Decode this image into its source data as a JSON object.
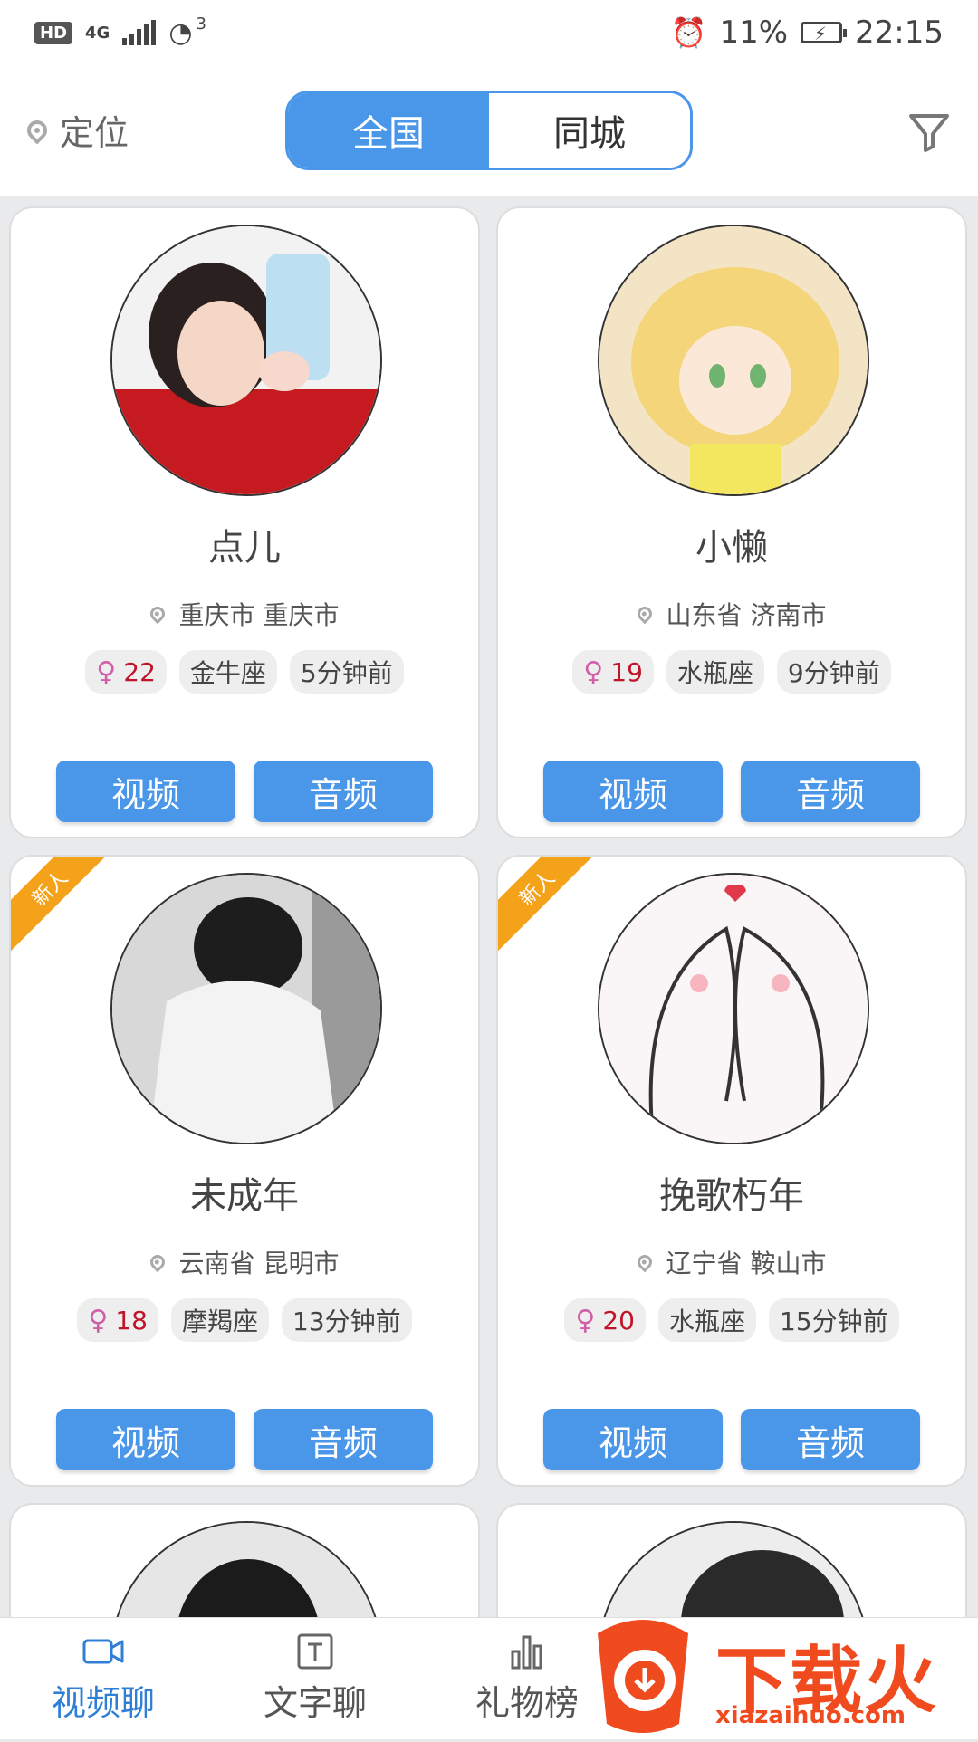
{
  "status_bar": {
    "left_badges": [
      "HD",
      "4G"
    ],
    "signal_extra": "3",
    "battery": "11%",
    "time": "22:15"
  },
  "top_bar": {
    "location_label": "定位",
    "tabs": [
      {
        "label": "全国",
        "active": true
      },
      {
        "label": "同城",
        "active": false
      }
    ]
  },
  "cards": [
    {
      "name": "点儿",
      "location": "重庆市 重庆市",
      "age": "22",
      "zodiac": "金牛座",
      "time": "5分钟前",
      "new": false
    },
    {
      "name": "小懒",
      "location": "山东省 济南市",
      "age": "19",
      "zodiac": "水瓶座",
      "time": "9分钟前",
      "new": false
    },
    {
      "name": "未成年",
      "location": "云南省 昆明市",
      "age": "18",
      "zodiac": "摩羯座",
      "time": "13分钟前",
      "new": true
    },
    {
      "name": "挽歌朽年",
      "location": "辽宁省 鞍山市",
      "age": "20",
      "zodiac": "水瓶座",
      "time": "15分钟前",
      "new": true
    }
  ],
  "card_buttons": {
    "video": "视频",
    "audio": "音频"
  },
  "new_ribbon": "新人",
  "bottom_nav": [
    {
      "label": "视频聊",
      "icon": "video-camera-icon",
      "active": true
    },
    {
      "label": "文字聊",
      "icon": "text-icon",
      "active": false
    },
    {
      "label": "礼物榜",
      "icon": "bar-chart-icon",
      "active": false
    }
  ],
  "watermark": {
    "text": "下载火",
    "url": "xiazaihuo.com"
  },
  "colors": {
    "accent": "#4a96e8",
    "ribbon": "#f5a21b",
    "age_text": "#c0142a",
    "watermark": "#f04a1f"
  }
}
